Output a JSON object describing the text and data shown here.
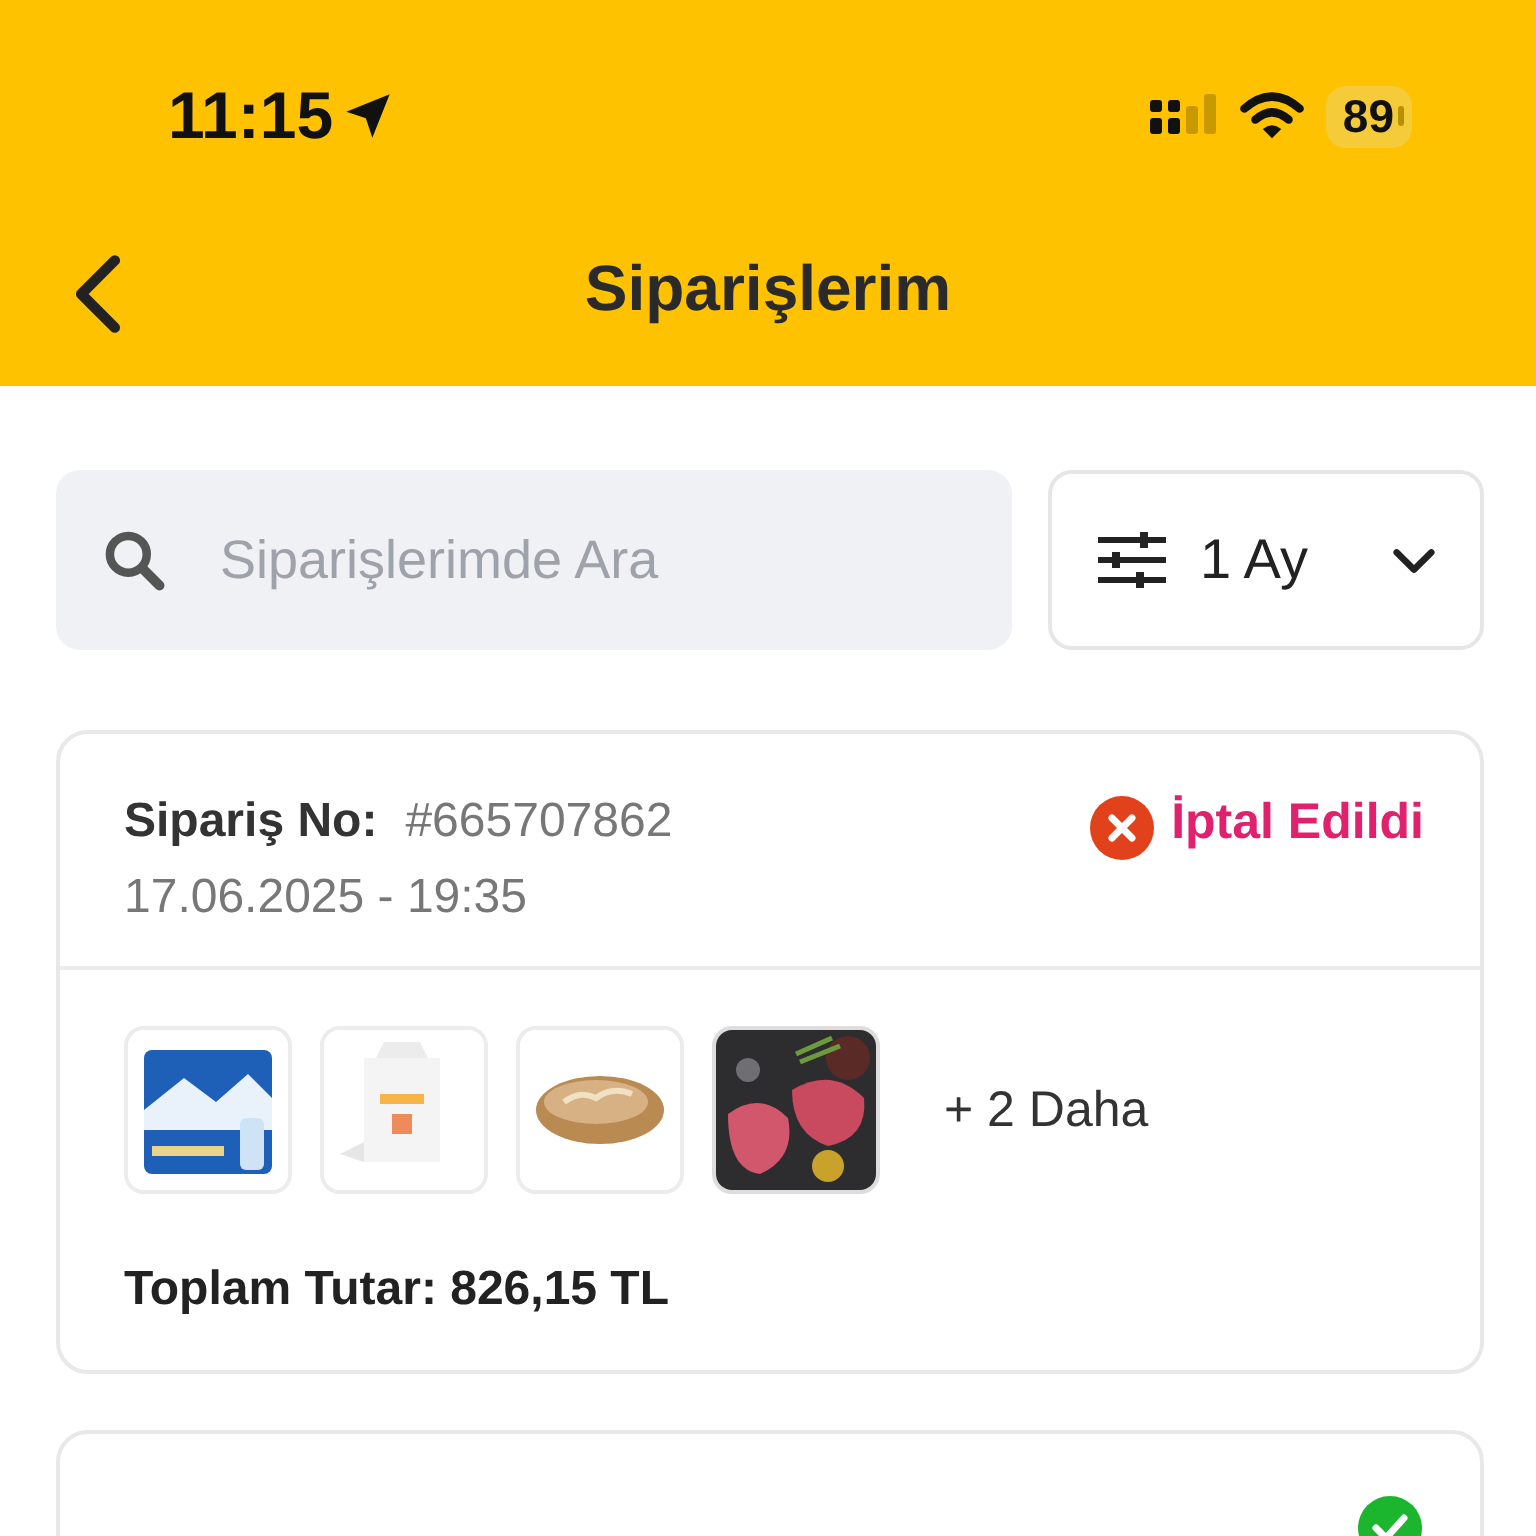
{
  "status_bar": {
    "time": "11:15",
    "battery": "89"
  },
  "header": {
    "title": "Siparişlerim"
  },
  "search": {
    "placeholder": "Siparişlerimde Ara"
  },
  "filter": {
    "label": "1 Ay"
  },
  "orders": [
    {
      "number_label": "Sipariş No:",
      "number": "#665707862",
      "date": "17.06.2025 - 19:35",
      "status": {
        "kind": "cancelled",
        "label": "İptal Edildi"
      },
      "more": "+ 2 Daha",
      "total": "Toplam Tutar: 826,15 TL"
    },
    {
      "status": {
        "kind": "delivered"
      }
    }
  ]
}
